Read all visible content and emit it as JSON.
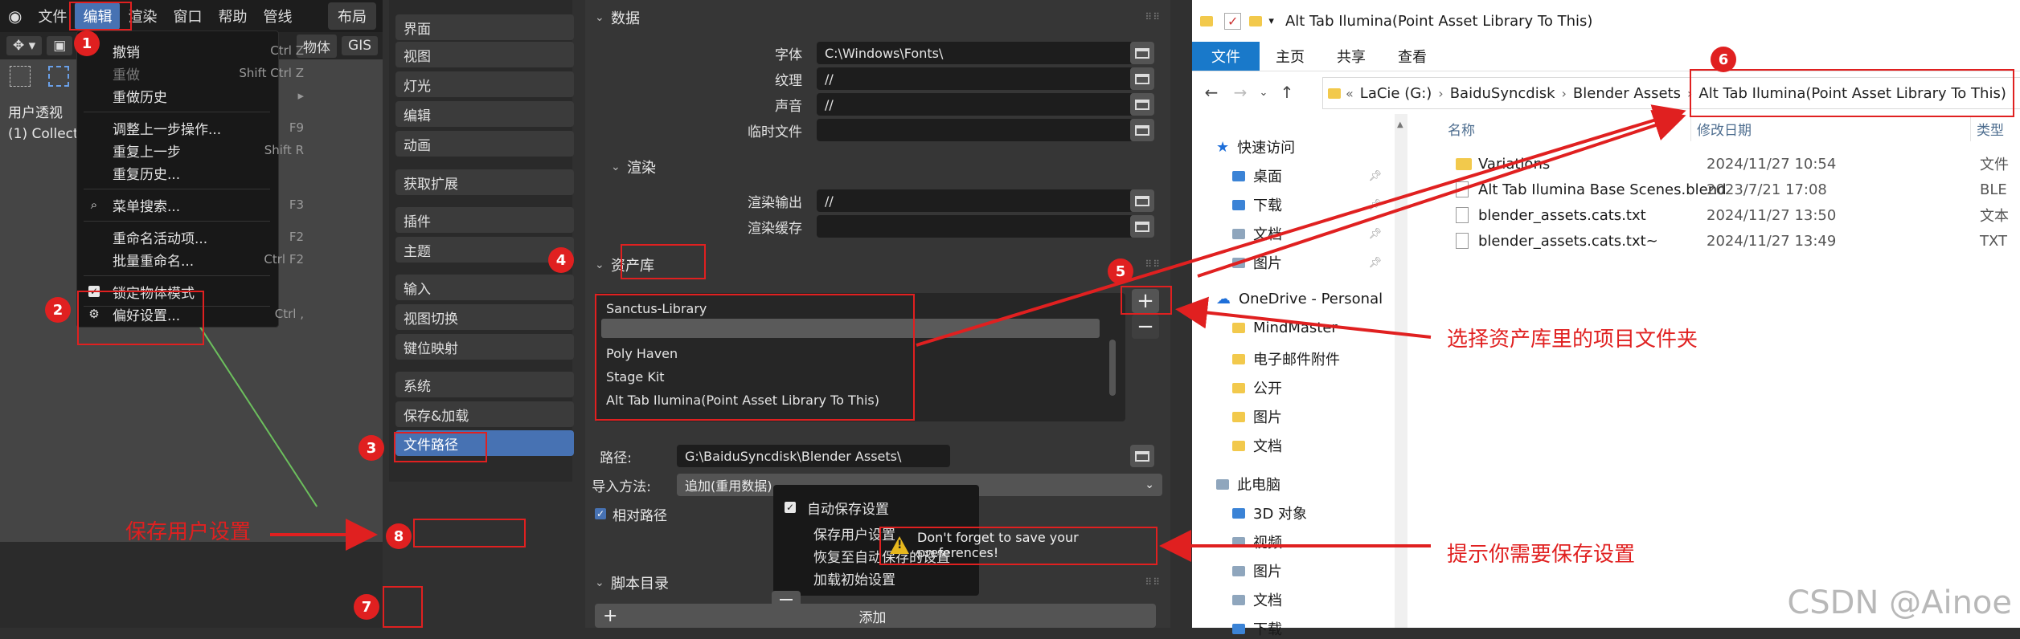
{
  "blender": {
    "menubar": [
      "文件",
      "编辑",
      "渲染",
      "窗口",
      "帮助",
      "管线"
    ],
    "layout_tab": "布局",
    "toolbar_labels": [
      "物体",
      "GIS"
    ],
    "view_label": [
      "用户透视",
      "(1) Collect"
    ],
    "edit_menu": [
      {
        "label": "撤销",
        "shortcut": "Ctrl Z",
        "dim": false
      },
      {
        "label": "重做",
        "shortcut": "Shift Ctrl Z",
        "dim": true
      },
      {
        "label": "重做历史",
        "shortcut": "▸",
        "dim": false
      },
      {
        "label": "调整上一步操作...",
        "shortcut": "F9",
        "dim": false
      },
      {
        "label": "重复上一步",
        "shortcut": "Shift R",
        "dim": false
      },
      {
        "label": "重复历史...",
        "shortcut": "",
        "dim": false
      },
      {
        "label": "菜单搜索...",
        "shortcut": "F3",
        "dim": false
      },
      {
        "label": "重命名活动项...",
        "shortcut": "F2",
        "dim": false
      },
      {
        "label": "批量重命名...",
        "shortcut": "Ctrl F2",
        "dim": false
      },
      {
        "label": "锁定物体模式",
        "shortcut": "",
        "dim": false
      },
      {
        "label": "偏好设置...",
        "shortcut": "Ctrl ,",
        "dim": false
      }
    ]
  },
  "prefs": {
    "categories": [
      "界面",
      "视图",
      "灯光",
      "编辑",
      "动画",
      "获取扩展",
      "插件",
      "主题",
      "输入",
      "视图切换",
      "键位映射",
      "系统",
      "保存&加载",
      "文件路径"
    ],
    "selected_category": "文件路径",
    "data_section": {
      "title": "数据",
      "rows": [
        {
          "label": "字体",
          "value": "C:\\Windows\\Fonts\\"
        },
        {
          "label": "纹理",
          "value": "//"
        },
        {
          "label": "声音",
          "value": "//"
        },
        {
          "label": "临时文件",
          "value": ""
        }
      ]
    },
    "render_section": {
      "title": "渲染",
      "rows": [
        {
          "label": "渲染输出",
          "value": "//"
        },
        {
          "label": "渲染缓存",
          "value": ""
        }
      ]
    },
    "asset_section": {
      "title": "资产库",
      "libraries": [
        "Sanctus-Library",
        "",
        "Poly Haven",
        "Stage Kit",
        "Alt Tab Ilumina(Point Asset Library To This)"
      ],
      "add_label": "+",
      "remove_label": "−",
      "path_label": "路径:",
      "path_value": "G:\\BaiduSyncdisk\\Blender Assets\\",
      "import_label": "导入方法:",
      "import_value": "追加(重用数据)",
      "relative_label": "相对路径",
      "warning": "Don't forget to save your preferences!"
    },
    "script_section": {
      "title": "脚本目录",
      "add": "添加"
    },
    "save_menu": [
      "自动保存设置",
      "保存用户设置",
      "恢复至自动保存的设置",
      "加载初始设置"
    ]
  },
  "explorer": {
    "title": "Alt Tab Ilumina(Point Asset Library To This)",
    "ribbon": [
      "文件",
      "主页",
      "共享",
      "查看"
    ],
    "breadcrumb": [
      "LaCie (G:)",
      "BaiduSyncdisk",
      "Blender Assets",
      "Alt Tab Ilumina(Point Asset Library To This)"
    ],
    "nav": [
      {
        "label": "快速访问",
        "kind": "star"
      },
      {
        "label": "桌面",
        "kind": "blue",
        "pin": true
      },
      {
        "label": "下载",
        "kind": "blue",
        "pin": true
      },
      {
        "label": "文档",
        "kind": "gray",
        "pin": true
      },
      {
        "label": "图片",
        "kind": "gray",
        "pin": true
      },
      {
        "label": "OneDrive - Personal",
        "kind": "cloud"
      },
      {
        "label": "MindMaster",
        "kind": "yellow"
      },
      {
        "label": "电子邮件附件",
        "kind": "yellow"
      },
      {
        "label": "公开",
        "kind": "yellow"
      },
      {
        "label": "图片",
        "kind": "yellow"
      },
      {
        "label": "文档",
        "kind": "yellow"
      },
      {
        "label": "此电脑",
        "kind": "pc"
      },
      {
        "label": "3D 对象",
        "kind": "blue"
      },
      {
        "label": "视频",
        "kind": "gray"
      },
      {
        "label": "图片",
        "kind": "gray"
      },
      {
        "label": "文档",
        "kind": "gray"
      },
      {
        "label": "下载",
        "kind": "blue"
      }
    ],
    "columns": [
      "名称",
      "修改日期",
      "类型"
    ],
    "files": [
      {
        "name": "Variations",
        "date": "2024/11/27 10:54",
        "type": "文件",
        "folder": true
      },
      {
        "name": "Alt Tab Ilumina Base Scenes.blend",
        "date": "2023/7/21 17:08",
        "type": "BLE",
        "folder": false
      },
      {
        "name": "blender_assets.cats.txt",
        "date": "2024/11/27 13:50",
        "type": "文本",
        "folder": false
      },
      {
        "name": "blender_assets.cats.txt~",
        "date": "2024/11/27 13:49",
        "type": "TXT",
        "folder": false
      }
    ]
  },
  "annotations": {
    "badges": [
      "1",
      "2",
      "3",
      "4",
      "5",
      "6",
      "7",
      "8"
    ],
    "select_folder": "选择资产库里的项目文件夹",
    "save_user_settings": "保存用户设置",
    "remind_save": "提示你需要保存设置",
    "watermark": "CSDN @Ainoe",
    "color": "#e02020"
  }
}
